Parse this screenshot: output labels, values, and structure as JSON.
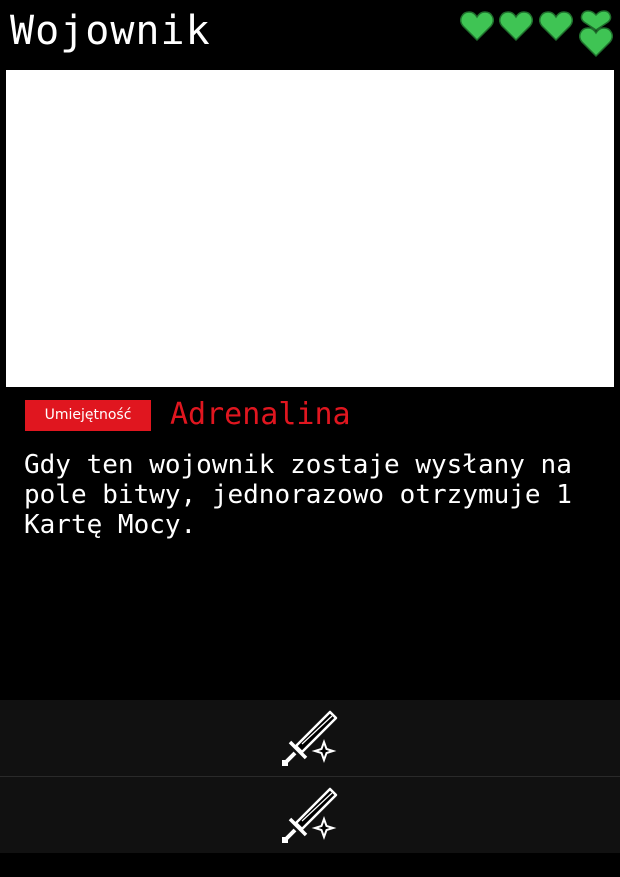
{
  "card": {
    "title": "Wojownik",
    "hearts": {
      "full": 3,
      "stacked": 1,
      "color": "#3fc454",
      "outline": "#1f6e2c"
    },
    "ability": {
      "badge": "Umiejętność",
      "name": "Adrenalina",
      "accent": "#e0161f"
    },
    "description": "Gdy ten wojownik zostaje wysłany na pole bitwy, jednorazowo otrzymuje 1 Kartę Mocy.",
    "slots": [
      {
        "icon": "sword-sparkle-icon"
      },
      {
        "icon": "sword-sparkle-icon"
      }
    ]
  }
}
